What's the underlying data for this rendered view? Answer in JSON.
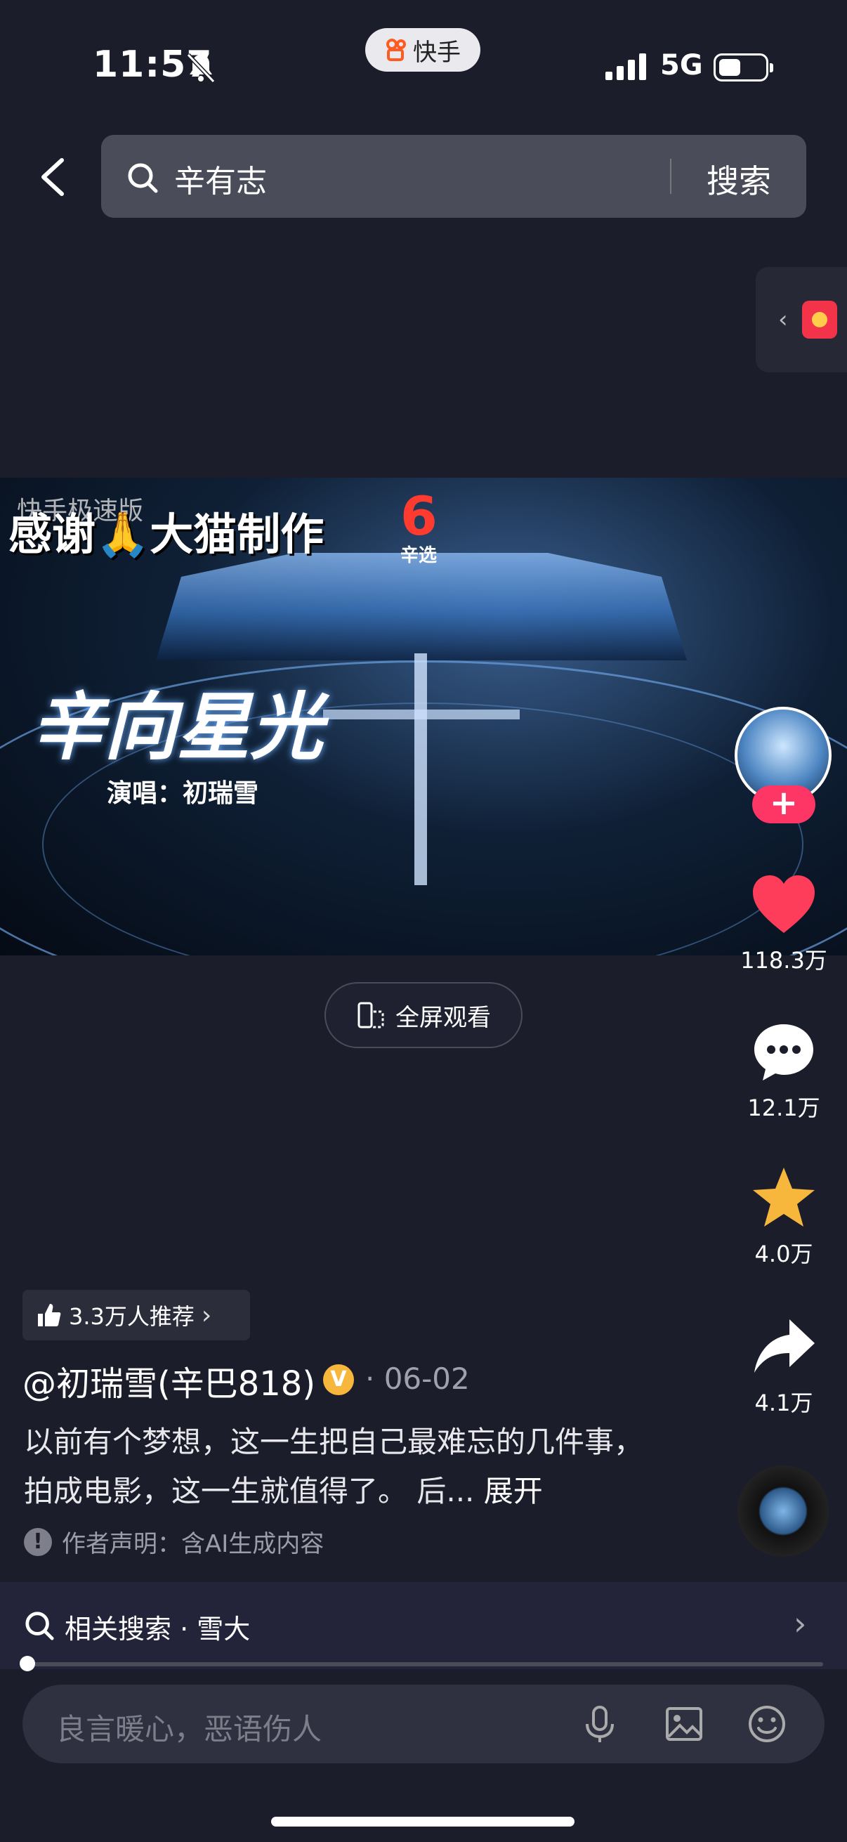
{
  "status_bar": {
    "time": "11:57",
    "network": "5G"
  },
  "app_pill": {
    "label": "快手"
  },
  "search": {
    "query": "辛有志",
    "button": "搜索"
  },
  "video": {
    "watermark": "快手极速版",
    "overlay_caption": "感谢🙏大猫制作",
    "brand_sub": "辛选",
    "song_title": "辛向星光",
    "singer_line": "演唱：初瑞雪"
  },
  "fullscreen": {
    "label": "全屏观看"
  },
  "actions": {
    "likes": "118.3万",
    "comments": "12.1万",
    "favorites": "4.0万",
    "shares": "4.1万"
  },
  "recommend": {
    "label": "3.3万人推荐"
  },
  "author": {
    "name": "@初瑞雪(辛巴818)",
    "date": "· 06-02"
  },
  "description": {
    "text": "以前有个梦想，这一生把自己最难忘的几件事，拍成电影，这一生就值得了。 后...",
    "more": "展开"
  },
  "declaration": {
    "text": "作者声明：含AI生成内容"
  },
  "related_search": {
    "label": "相关搜索 · 雪大"
  },
  "progress": {
    "fraction": 0.0
  },
  "comment_input": {
    "placeholder": "良言暖心，恶语伤人"
  },
  "colors": {
    "background": "#1c1d2a",
    "like": "#fe3d5a",
    "star": "#f6b73c",
    "follow": "#fe3666"
  }
}
